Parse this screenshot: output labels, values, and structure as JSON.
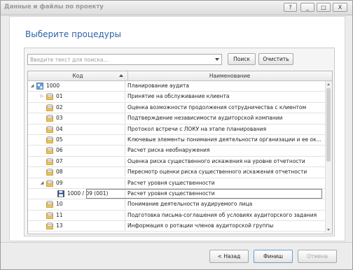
{
  "window": {
    "title": "Данные и файлы по проекту",
    "help_label": "?",
    "minimize_label": "_",
    "maximize_label": "□",
    "close_label": "X"
  },
  "page": {
    "heading": "Выберите процедуры"
  },
  "search": {
    "placeholder": "Введите текст для поиска...",
    "value": "",
    "find_label": "Поиск",
    "clear_label": "Очистить"
  },
  "grid": {
    "columns": [
      "Код",
      "Наименование"
    ],
    "rows": [
      {
        "code": "1000",
        "name": "Планирование аудита",
        "level": 0,
        "expander": "open",
        "icon": "root-folder-icon"
      },
      {
        "code": "01",
        "name": "Принятие на обслуживание клиента",
        "level": 1,
        "expander": "closed",
        "icon": "folder-doc-icon"
      },
      {
        "code": "02",
        "name": "Оценка возможности продолжения сотрудничества с клиентом",
        "level": 1,
        "expander": "",
        "icon": "folder-doc-icon"
      },
      {
        "code": "03",
        "name": "Подтверждение независимости аудиторской компании",
        "level": 1,
        "expander": "",
        "icon": "folder-doc-icon"
      },
      {
        "code": "04",
        "name": "Протокол встречи с ЛОКУ на этапе планирования",
        "level": 1,
        "expander": "",
        "icon": "folder-doc-icon"
      },
      {
        "code": "05",
        "name": "Ключевые элементы понимания деятельности организации и ее ок...",
        "level": 1,
        "expander": "",
        "icon": "folder-doc-icon"
      },
      {
        "code": "06",
        "name": "Расчет риска необнаружения",
        "level": 1,
        "expander": "",
        "icon": "folder-doc-icon"
      },
      {
        "code": "07",
        "name": "Оценка риска существенного искажения на уровне отчетности",
        "level": 1,
        "expander": "",
        "icon": "folder-doc-icon"
      },
      {
        "code": "08",
        "name": "Пересмотр оценки риска существенного искажения отчетности",
        "level": 1,
        "expander": "",
        "icon": "folder-doc-icon"
      },
      {
        "code": "09",
        "name": "Расчет уровня существенности",
        "level": 1,
        "expander": "open",
        "icon": "folder-doc-icon"
      },
      {
        "code": "1000 / 09 (001)",
        "name": "Расчет уровня существенности",
        "level": 2,
        "expander": "",
        "icon": "floppy-disk-icon",
        "selected": true
      },
      {
        "code": "10",
        "name": "Понимание деятельности аудируемого лица",
        "level": 1,
        "expander": "",
        "icon": "folder-doc-icon"
      },
      {
        "code": "11",
        "name": "Подготовка письма-соглашения об условиях аудиторского задания",
        "level": 1,
        "expander": "",
        "icon": "folder-doc-icon"
      },
      {
        "code": "13",
        "name": "Информация о ротации членов аудиторской группы",
        "level": 1,
        "expander": "",
        "icon": "folder-doc-icon"
      }
    ]
  },
  "footer": {
    "back_label": "< Назад",
    "finish_label": "Финиш",
    "cancel_label": "Отмена"
  },
  "colors": {
    "heading": "#2b62a7",
    "window_bg": "#ececec",
    "grid_border": "#b9b9b9"
  }
}
